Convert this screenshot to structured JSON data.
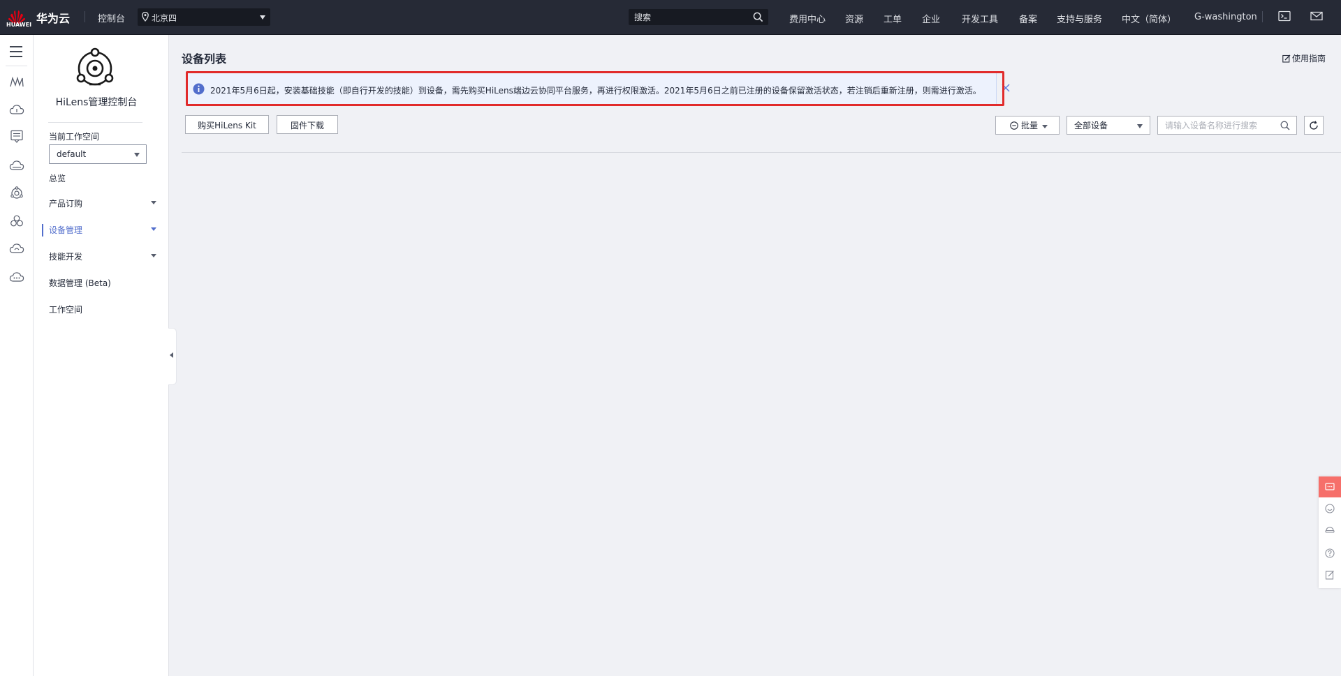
{
  "topbar": {
    "logo_text": "HUAWEI",
    "brand": "华为云",
    "console": "控制台",
    "region": "北京四",
    "search_placeholder": "搜索",
    "nav": [
      "费用中心",
      "资源",
      "工单",
      "企业",
      "开发工具",
      "备案",
      "支持与服务",
      "中文（简体）",
      "G-washington"
    ],
    "icons": [
      "cloud-shell-icon",
      "mail-icon"
    ]
  },
  "rail": {
    "icons": [
      "menu-icon",
      "modelarts-icon",
      "cloud-service-icon",
      "iot-device-icon",
      "cloud-icon",
      "hilens-icon",
      "cloud-cluster-icon",
      "cloud-sync-icon",
      "more-services-icon"
    ]
  },
  "sidenav": {
    "service_title": "HiLens管理控制台",
    "workspace_label": "当前工作空间",
    "workspace_value": "default",
    "items": [
      {
        "label": "总览",
        "expandable": false
      },
      {
        "label": "产品订购",
        "expandable": true
      },
      {
        "label": "设备管理",
        "expandable": true,
        "active": true
      },
      {
        "label": "技能开发",
        "expandable": true
      },
      {
        "label": "数据管理 (Beta)",
        "expandable": false
      },
      {
        "label": "工作空间",
        "expandable": false
      }
    ]
  },
  "main": {
    "title": "设备列表",
    "guide": "使用指南",
    "notice": "2021年5月6日起，安装基础技能（即自行开发的技能）到设备，需先购买HiLens端边云协同平台服务，再进行权限激活。2021年5月6日之前已注册的设备保留激活状态，若注销后重新注册，则需进行激活。",
    "buttons": {
      "buy": "购买HiLens Kit",
      "firmware": "固件下载",
      "batch": "批量"
    },
    "filter_value": "全部设备",
    "search_placeholder": "请输入设备名称进行搜索"
  },
  "colors": {
    "topbar_bg": "#262a36",
    "accent": "#526ecc",
    "highlight_outline": "#e12b2b",
    "notice_bg": "#edf2fd",
    "float_top": "#f66f6a"
  }
}
